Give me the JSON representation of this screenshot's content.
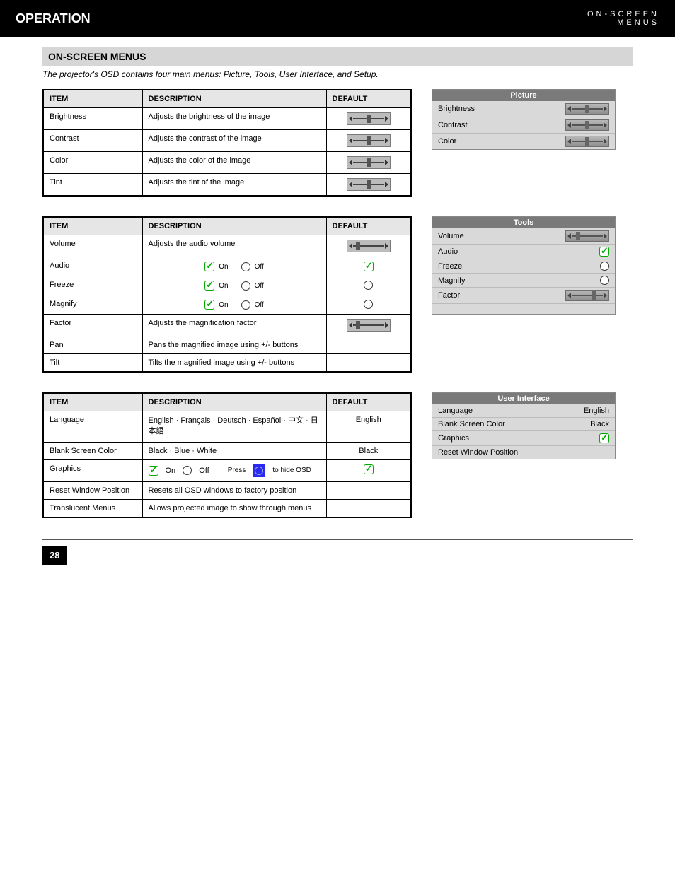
{
  "header": {
    "title": "OPERATION",
    "subtitle_line1": "ON-SCREEN",
    "subtitle_line2": "MENUS"
  },
  "section_bar": "ON-SCREEN MENUS",
  "intro_line": "The projector's OSD contains four main menus: Picture, Tools, User Interface, and Setup.",
  "picture_table": {
    "headers": [
      "ITEM",
      "DESCRIPTION",
      "DEFAULT"
    ],
    "rows": [
      {
        "item": "Brightness",
        "desc": "Adjusts the brightness of the image",
        "default_icon": "slider-mid"
      },
      {
        "item": "Contrast",
        "desc": "Adjusts the contrast of the image",
        "default_icon": "slider-mid"
      },
      {
        "item": "Color",
        "desc": "Adjusts the color of the image",
        "default_icon": "slider-mid"
      },
      {
        "item": "Tint",
        "desc": "Adjusts the tint of the image",
        "default_icon": "slider-mid"
      }
    ]
  },
  "picture_osd": {
    "title": "Picture",
    "rows": [
      {
        "label": "Brightness",
        "control": "slider"
      },
      {
        "label": "Contrast",
        "control": "slider"
      },
      {
        "label": "Color",
        "control": "slider"
      }
    ]
  },
  "tools_table": {
    "headers": [
      "ITEM",
      "DESCRIPTION",
      "DEFAULT"
    ],
    "rows": [
      {
        "item": "Volume",
        "desc": "Adjusts the audio volume",
        "default_icon": "slider-low"
      },
      {
        "item": "Audio",
        "desc_on": "On",
        "desc_off": "Off",
        "default_icon": "check-on"
      },
      {
        "item": "Freeze",
        "desc_on": "On",
        "desc_off": "Off",
        "default_icon": "radio-off"
      },
      {
        "item": "Magnify",
        "desc_on": "On",
        "desc_off": "Off",
        "default_icon": "radio-off"
      },
      {
        "item": "Factor",
        "desc": "Adjusts the magnification factor",
        "default_icon": "slider-mag"
      },
      {
        "item": "Pan",
        "desc": "Pans the magnified image using +/- buttons",
        "default_text": ""
      },
      {
        "item": "Tilt",
        "desc": "Tilts the magnified image using +/- buttons",
        "default_text": ""
      }
    ]
  },
  "tools_osd": {
    "title": "Tools",
    "rows": [
      {
        "label": "Volume",
        "control": "slider-low"
      },
      {
        "label": "Audio",
        "control": "check-on"
      },
      {
        "label": "Freeze",
        "control": "radio-off"
      },
      {
        "label": "Magnify",
        "control": "radio-off"
      },
      {
        "label": "Factor",
        "control": "slider-mright"
      }
    ]
  },
  "ui_table": {
    "headers": [
      "ITEM",
      "DESCRIPTION",
      "DEFAULT"
    ],
    "rows": [
      {
        "item": "Language",
        "desc_list": "English · Français · Deutsch · Español · 中文 · 日本語",
        "default_text": "English"
      },
      {
        "item": "Blank Screen Color",
        "desc": "Black · Blue · White",
        "default_text": "Black"
      },
      {
        "item": "Graphics",
        "desc_on_label": "On",
        "desc_off_label": "Off",
        "desc_note": "Press   to hide\nOSD graphics",
        "default_icon": "check-on"
      },
      {
        "item": "Reset Window Position",
        "desc": "Resets all OSD windows to factory position",
        "default_text": ""
      },
      {
        "item": "Translucent Menus",
        "desc": "Allows projected image to show through menus",
        "default_text": ""
      }
    ]
  },
  "ui_osd": {
    "title": "User Interface",
    "rows": [
      {
        "label": "Language",
        "value": "English"
      },
      {
        "label": "Blank Screen Color",
        "value": "Black"
      },
      {
        "label": "Graphics",
        "control": "check-on"
      },
      {
        "label": "Reset Window Position",
        "value": ""
      }
    ]
  },
  "footer": {
    "page_number": "28"
  }
}
